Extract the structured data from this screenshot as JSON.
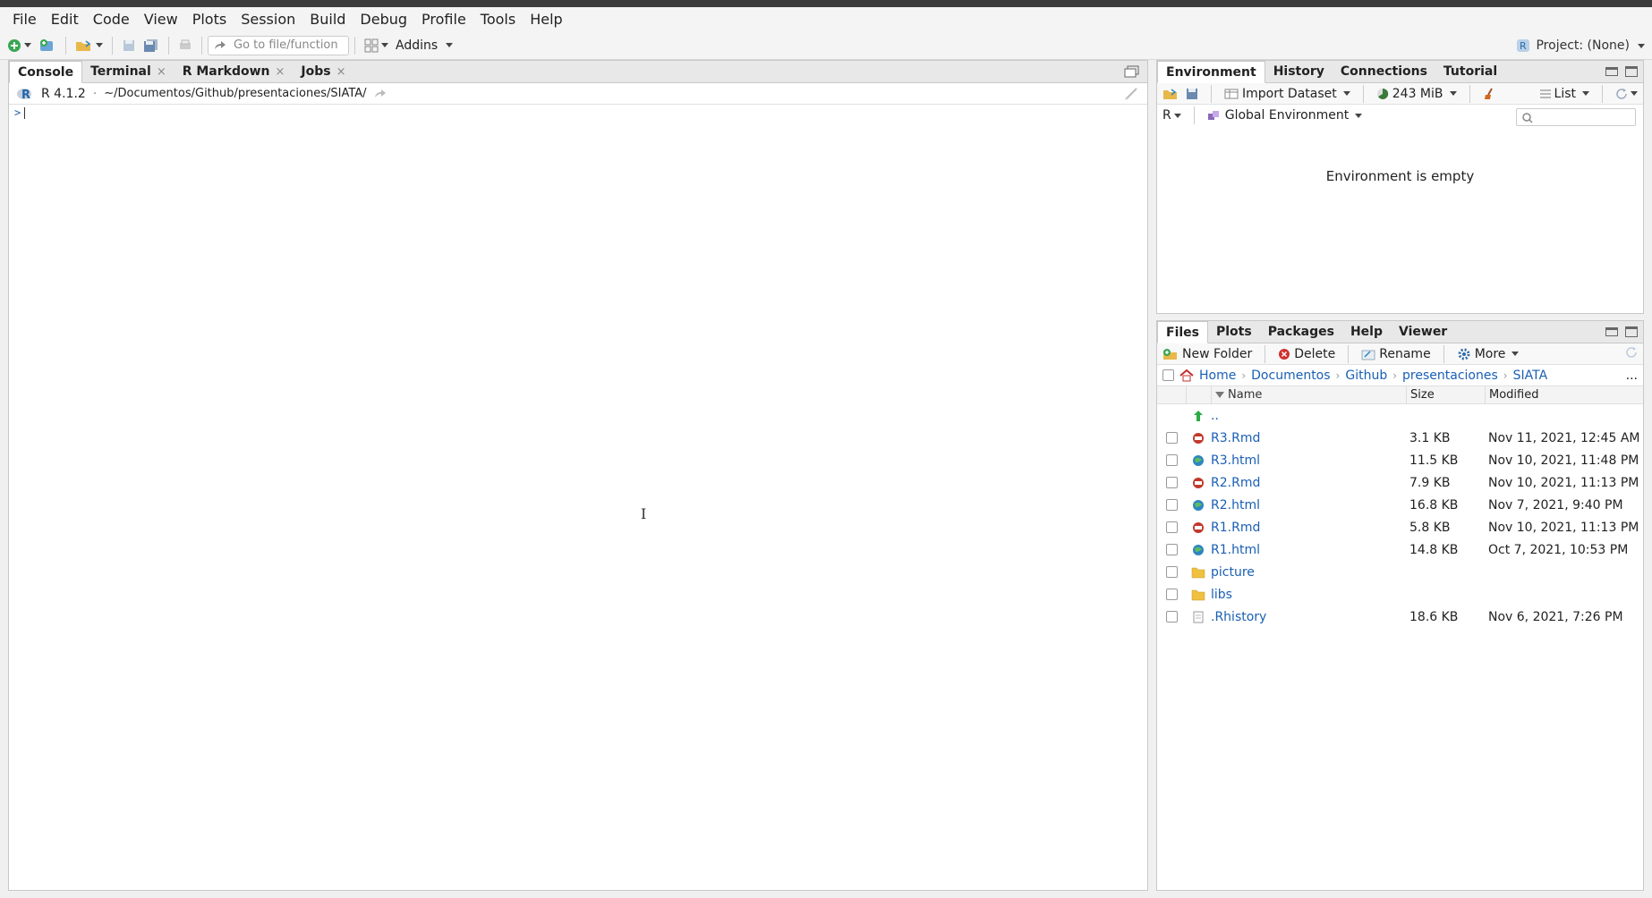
{
  "menu": [
    "File",
    "Edit",
    "Code",
    "View",
    "Plots",
    "Session",
    "Build",
    "Debug",
    "Profile",
    "Tools",
    "Help"
  ],
  "toolbar": {
    "goto_placeholder": "Go to file/function",
    "addins_label": "Addins",
    "project_label": "Project: (None)"
  },
  "left_pane": {
    "tabs": [
      {
        "label": "Console",
        "closable": false
      },
      {
        "label": "Terminal",
        "closable": true
      },
      {
        "label": "R Markdown",
        "closable": true
      },
      {
        "label": "Jobs",
        "closable": true
      }
    ],
    "r_version": "R 4.1.2",
    "separator": "·",
    "working_dir": "~/Documentos/Github/presentaciones/SIATA/",
    "prompt": ">"
  },
  "env_pane": {
    "tabs": [
      "Environment",
      "History",
      "Connections",
      "Tutorial"
    ],
    "import_dataset": "Import Dataset",
    "memory": "243 MiB",
    "view_mode": "List",
    "language": "R",
    "scope": "Global Environment",
    "empty_message": "Environment is empty"
  },
  "files_pane": {
    "tabs": [
      "Files",
      "Plots",
      "Packages",
      "Help",
      "Viewer"
    ],
    "actions": {
      "new_folder": "New Folder",
      "delete": "Delete",
      "rename": "Rename",
      "more": "More"
    },
    "breadcrumb": [
      "Home",
      "Documentos",
      "Github",
      "presentaciones",
      "SIATA"
    ],
    "more_dots": "...",
    "columns": {
      "name": "Name",
      "size": "Size",
      "modified": "Modified"
    },
    "parent_dir": "..",
    "files": [
      {
        "name": "R3.Rmd",
        "size": "3.1 KB",
        "modified": "Nov 11, 2021, 12:45 AM",
        "type": "rmd"
      },
      {
        "name": "R3.html",
        "size": "11.5 KB",
        "modified": "Nov 10, 2021, 11:48 PM",
        "type": "html"
      },
      {
        "name": "R2.Rmd",
        "size": "7.9 KB",
        "modified": "Nov 10, 2021, 11:13 PM",
        "type": "rmd"
      },
      {
        "name": "R2.html",
        "size": "16.8 KB",
        "modified": "Nov 7, 2021, 9:40 PM",
        "type": "html"
      },
      {
        "name": "R1.Rmd",
        "size": "5.8 KB",
        "modified": "Nov 10, 2021, 11:13 PM",
        "type": "rmd"
      },
      {
        "name": "R1.html",
        "size": "14.8 KB",
        "modified": "Oct 7, 2021, 10:53 PM",
        "type": "html"
      },
      {
        "name": "picture",
        "size": "",
        "modified": "",
        "type": "folder"
      },
      {
        "name": "libs",
        "size": "",
        "modified": "",
        "type": "folder"
      },
      {
        "name": ".Rhistory",
        "size": "18.6 KB",
        "modified": "Nov 6, 2021, 7:26 PM",
        "type": "text"
      }
    ]
  },
  "colors": {
    "link": "#1a5fb4",
    "rmd_icon": "#c0392b",
    "html_icon": "#2e86c1",
    "folder": "#f0c040"
  }
}
